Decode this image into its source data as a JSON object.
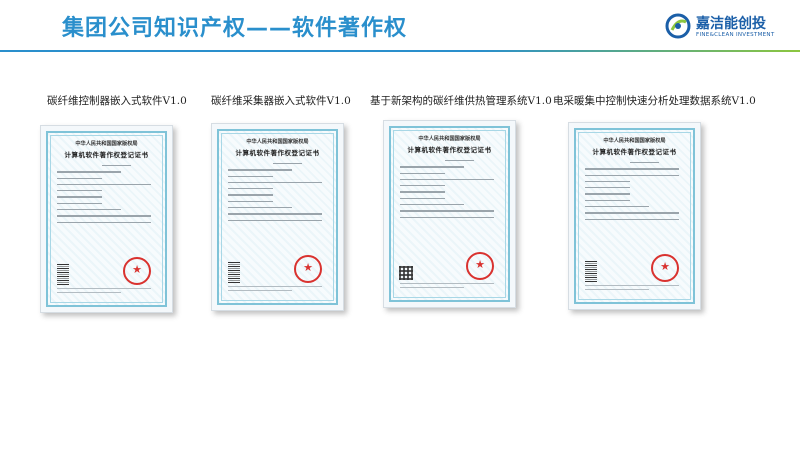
{
  "header": {
    "title": "集团公司知识产权——软件著作权",
    "logo_cn": "嘉洁能创投",
    "logo_en": "FINE&CLEAN INVESTMENT",
    "colors": {
      "primary": "#2a8fcc",
      "accent": "#8cc63f",
      "logo": "#1b5fa8"
    }
  },
  "certificates": [
    {
      "title": "碳纤维控制器嵌入式软件V1.0",
      "doc_head1": "中华人民共和国国家版权局",
      "doc_head2": "计算机软件著作权登记证书"
    },
    {
      "title": "碳纤维采集器嵌入式软件V1.0",
      "doc_head1": "中华人民共和国国家版权局",
      "doc_head2": "计算机软件著作权登记证书"
    },
    {
      "title": "基于新架构的碳纤维供热管理系统V1.0",
      "doc_head1": "中华人民共和国国家版权局",
      "doc_head2": "计算机软件著作权登记证书"
    },
    {
      "title": "电采暖集中控制快速分析处理数据系统V1.0",
      "doc_head1": "中华人民共和国国家版权局",
      "doc_head2": "计算机软件著作权登记证书"
    }
  ]
}
